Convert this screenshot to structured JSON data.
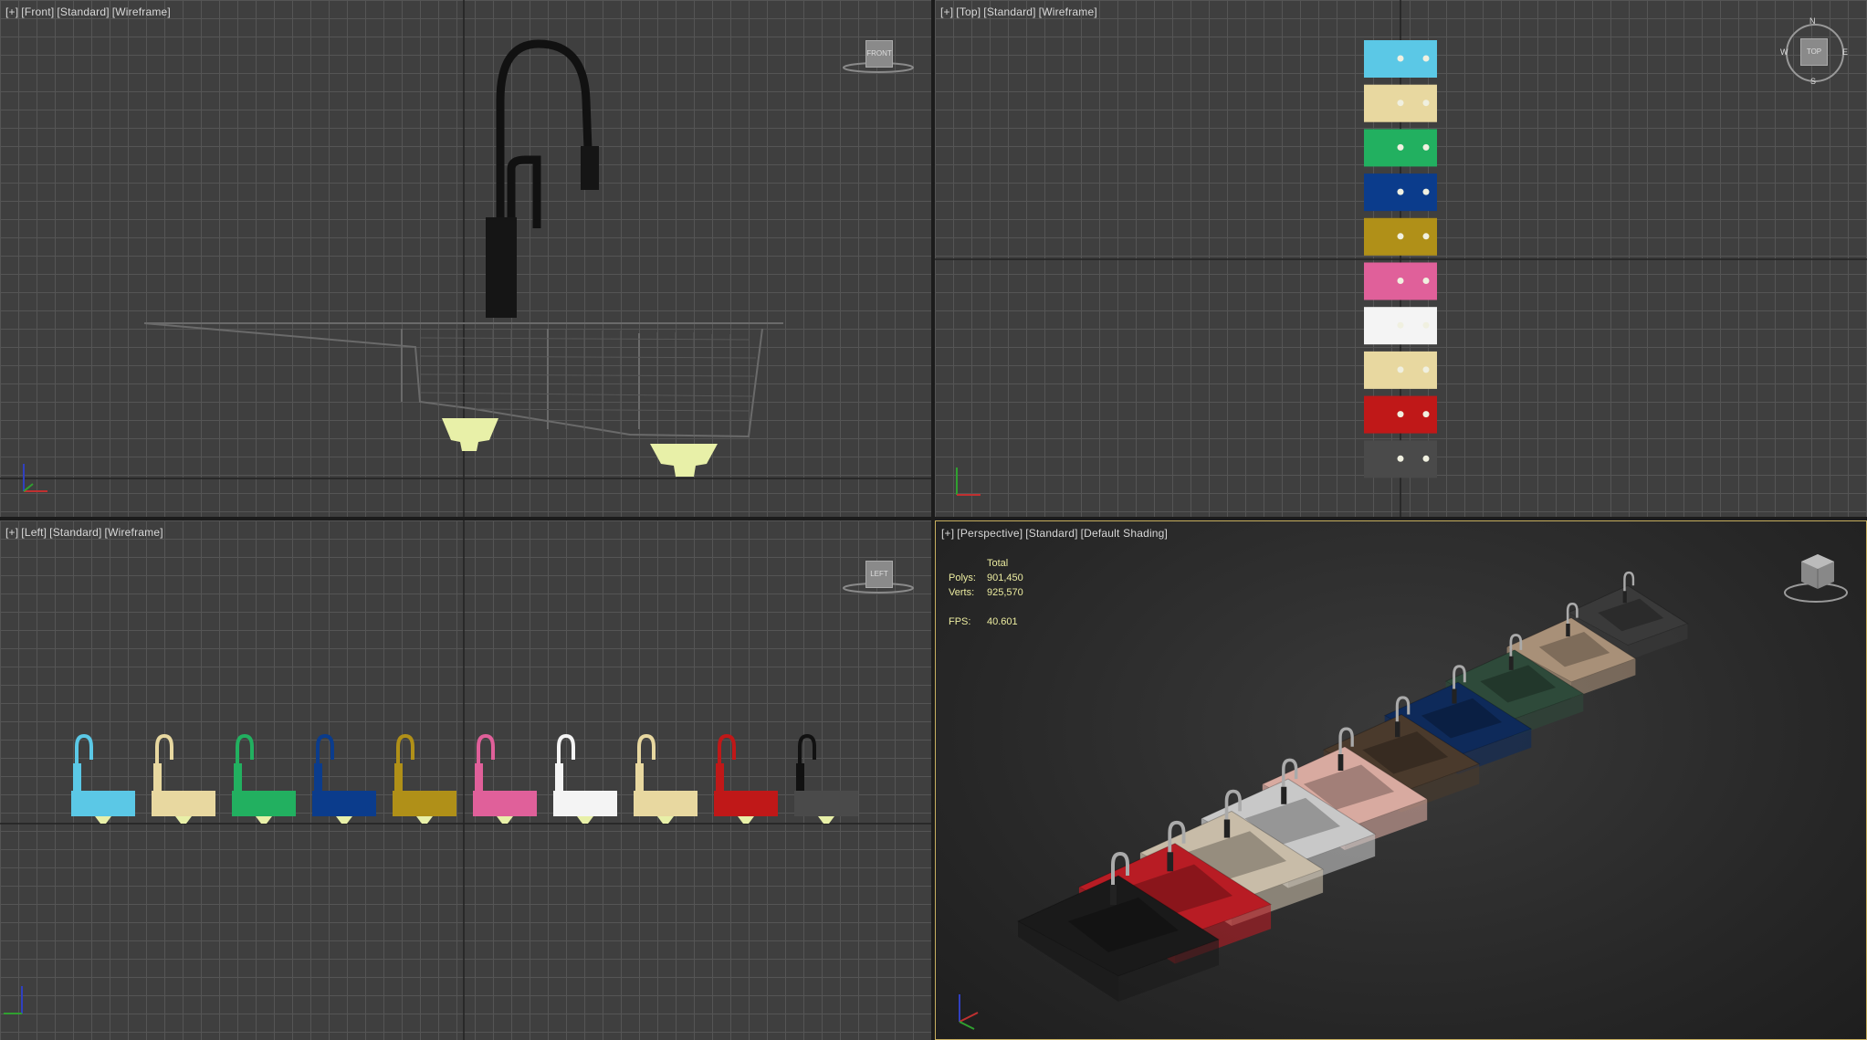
{
  "viewports": {
    "front": {
      "label": [
        "[+]",
        "[Front]",
        "[Standard]",
        "[Wireframe]"
      ],
      "cube_label": "FRONT"
    },
    "top": {
      "label": [
        "[+]",
        "[Top]",
        "[Standard]",
        "[Wireframe]"
      ],
      "cube_label": "TOP",
      "compass": {
        "n": "N",
        "s": "S",
        "e": "E",
        "w": "W"
      }
    },
    "left": {
      "label": [
        "[+]",
        "[Left]",
        "[Standard]",
        "[Wireframe]"
      ],
      "cube_label": "LEFT"
    },
    "perspective": {
      "label": [
        "[+]",
        "[Perspective]",
        "[Standard]",
        "[Default Shading]"
      ]
    }
  },
  "stats": {
    "total_label": "Total",
    "polys_label": "Polys:",
    "polys_value": "901,450",
    "verts_label": "Verts:",
    "verts_value": "925,570",
    "fps_label": "FPS:",
    "fps_value": "40.601"
  },
  "sink_colors": [
    "#5bc8e6",
    "#e8d8a0",
    "#22b060",
    "#0b3c8c",
    "#b09018",
    "#e0609a",
    "#f4f4f4",
    "#e8d8a0",
    "#c01818",
    "#4a4a4a"
  ],
  "faucet_colors": [
    "#5bc8e6",
    "#e8d8a0",
    "#22b060",
    "#0b3c8c",
    "#b09018",
    "#e0609a",
    "#f4f4f4",
    "#e8d8a0",
    "#c01818",
    "#111111"
  ],
  "perspective_sink_colors": [
    "#1a1a1a",
    "#b81c24",
    "#c8bca8",
    "#c8c8c8",
    "#d8aaa0",
    "#4a3a2c",
    "#0e2a5a",
    "#2e4a3a",
    "#a89078",
    "#3a3a3a"
  ],
  "accent": {
    "active_border": "#c8b060",
    "stats_text": "#ececa0",
    "strainer": "#e8f0a8"
  }
}
